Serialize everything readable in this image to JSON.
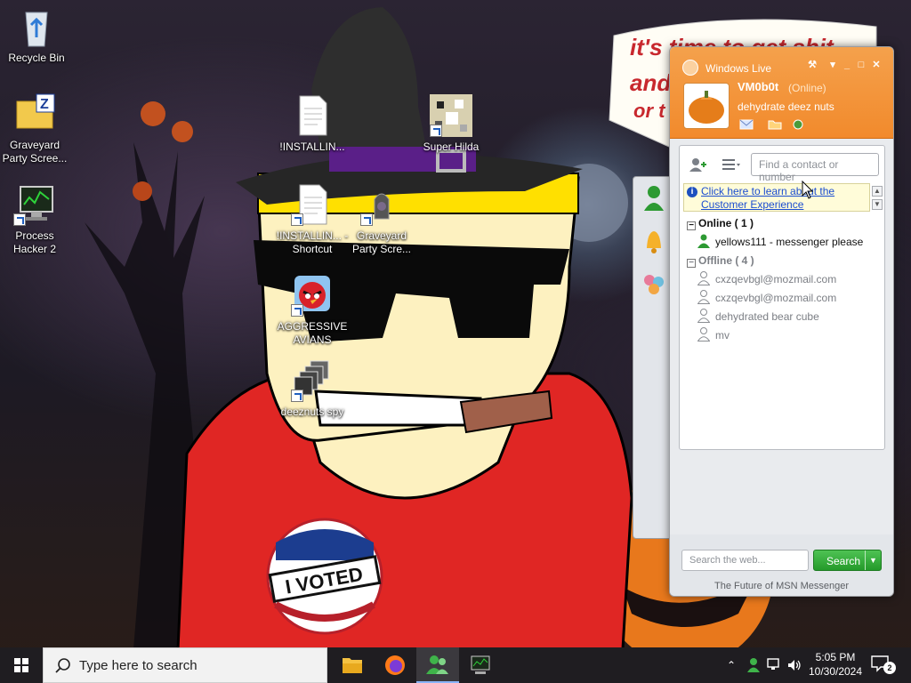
{
  "wallpaper": {
    "speech_lines": [
      "it's time to get shit",
      "and",
      "or t"
    ]
  },
  "desktop_icons": [
    {
      "label": "Recycle Bin"
    },
    {
      "label": "Graveyard Party Scree..."
    },
    {
      "label": "Process Hacker 2"
    },
    {
      "label": "!INSTALLIN..."
    },
    {
      "label": "!INSTALLIN... - Shortcut"
    },
    {
      "label": "AGGRESSIVE AVIANS"
    },
    {
      "label": "deeznuts spy"
    },
    {
      "label": "Super Hilda"
    },
    {
      "label": "Graveyard Party Scre..."
    }
  ],
  "messenger": {
    "title": "Windows Live",
    "user": {
      "display_name": "VM0b0t",
      "status": "(Online)",
      "personal_message": "dehydrate deez nuts"
    },
    "find_placeholder": "Find a contact or number",
    "info_link": "Click here to learn about the Customer Experience",
    "groups": {
      "online": {
        "label": "Online ( 1 )",
        "contacts": [
          "yellows111 - messenger please"
        ]
      },
      "offline": {
        "label": "Offline ( 4 )",
        "contacts": [
          "cxzqevbgl@mozmail.com",
          "cxzqevbgl@mozmail.com",
          "dehydrated bear cube",
          "mv"
        ]
      }
    },
    "web_search_placeholder": "Search the web...",
    "search_button": "Search",
    "footer": "The Future of MSN Messenger"
  },
  "taskbar": {
    "search_text": "Type here to search",
    "time": "5:05 PM",
    "date": "10/30/2024",
    "notification_count": "2"
  },
  "colors": {
    "messenger_header": "#f28a2c",
    "online_green": "#2d9a33",
    "link_blue": "#1b4dd0",
    "search_green": "#249a2a"
  },
  "icons": [
    "recycle-bin-icon",
    "folder-zip-icon",
    "monitor-icon",
    "document-icon",
    "angry-bird-icon",
    "windows-stack-icon",
    "pixel-art-icon",
    "game-icon",
    "butterfly-logo-icon",
    "add-contact-icon",
    "list-view-icon",
    "info-icon",
    "buddy-online-icon",
    "buddy-offline-icon",
    "mail-icon",
    "folder-icon",
    "globe-icon",
    "bell-icon",
    "people-icon",
    "windows-start-icon",
    "search-icon",
    "file-explorer-icon",
    "firefox-icon",
    "messenger-icon",
    "network-icon",
    "volume-icon",
    "notification-icon"
  ]
}
